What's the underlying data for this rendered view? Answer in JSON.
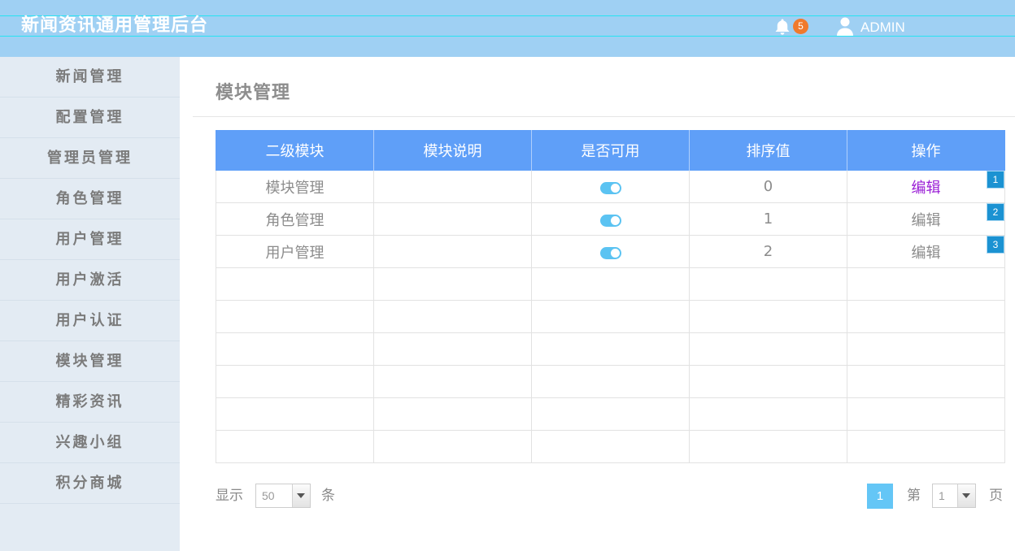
{
  "app": {
    "title": "新闻资讯通用管理后台"
  },
  "header": {
    "notifications": {
      "icon": "bell-icon",
      "count": "5"
    },
    "user": {
      "icon": "user-icon",
      "name": "ADMIN"
    }
  },
  "sidebar": {
    "items": [
      {
        "label": "新闻管理"
      },
      {
        "label": "配置管理"
      },
      {
        "label": "管理员管理"
      },
      {
        "label": "角色管理"
      },
      {
        "label": "用户管理"
      },
      {
        "label": "用户激活"
      },
      {
        "label": "用户认证"
      },
      {
        "label": "模块管理"
      },
      {
        "label": "精彩资讯"
      },
      {
        "label": "兴趣小组"
      },
      {
        "label": "积分商城"
      }
    ]
  },
  "main": {
    "title": "模块管理",
    "table": {
      "columns": [
        "二级模块",
        "模块说明",
        "是否可用",
        "排序值",
        "操作"
      ],
      "rows": [
        {
          "module": "模块管理",
          "description": "",
          "enabled": true,
          "sort": "0",
          "action": "编辑",
          "visited": true,
          "marker": "1"
        },
        {
          "module": "角色管理",
          "description": "",
          "enabled": true,
          "sort": "1",
          "action": "编辑",
          "visited": false,
          "marker": "2"
        },
        {
          "module": "用户管理",
          "description": "",
          "enabled": true,
          "sort": "2",
          "action": "编辑",
          "visited": false,
          "marker": "3"
        }
      ]
    }
  },
  "pagination": {
    "show_label": "显示",
    "page_size": "50",
    "unit_label": "条",
    "current_page": "1",
    "page_prefix": "第",
    "page_select": "1",
    "page_suffix": "页",
    "dropdown_icon": "caret-down-icon"
  },
  "colors": {
    "header_bg": "#9fd0f3",
    "sidebar_bg": "#e3ebf3",
    "table_header_bg": "#5f9ff8",
    "toggle_on": "#5bc3f2",
    "notification_badge": "#f07a2c",
    "active_page": "#64c6f6",
    "visited_link": "#9a1fd6",
    "marker_bg": "#1b92d2"
  }
}
